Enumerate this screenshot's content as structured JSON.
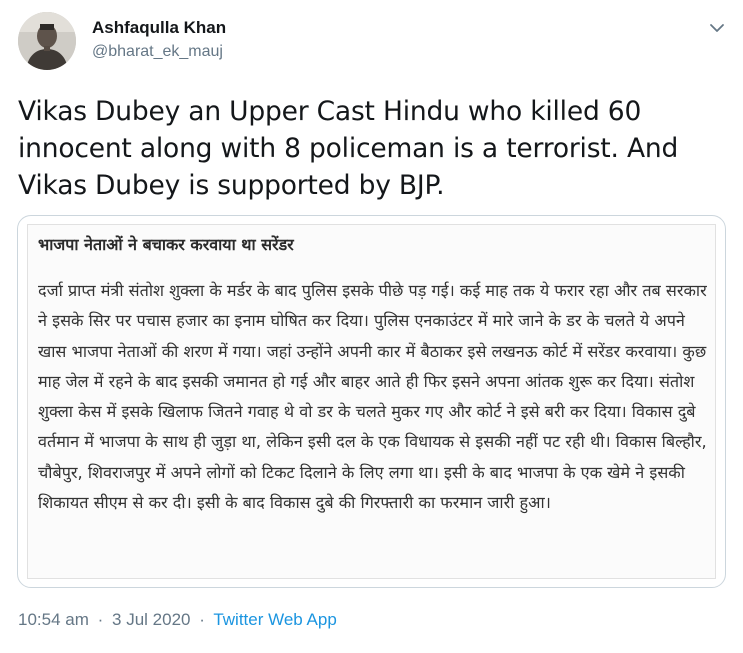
{
  "user": {
    "name": "Ashfaqulla Khan",
    "handle": "@bharat_ek_mauj"
  },
  "tweet": {
    "text": "Vikas Dubey an Upper Cast Hindu who killed 60 innocent along with 8 policeman is a terrorist. And Vikas Dubey is supported by BJP."
  },
  "quoted_image": {
    "headline": "भाजपा नेताओं ने बचाकर करवाया था सरेंडर",
    "body": "दर्जा प्राप्त मंत्री संतोश शुक्ला के मर्डर के बाद पुलिस इसके पीछे पड़ गई। कई माह तक ये फरार रहा और तब सरकार ने इसके सिर पर पचास हजार का इनाम घोषित कर दिया। पुलिस एनकाउंटर में मारे जाने के डर के चलते ये अपने खास भाजपा नेताओं की शरण में गया। जहां उन्होंने अपनी कार में बैठाकर इसे लखनऊ कोर्ट में सरेंडर करवाया। कुछ माह जेल में रहने के बाद इसकी जमानत हो गई और बाहर आते ही फिर इसने अपना आंतक शुरू कर दिया। संतोश शुक्ला केस में इसके खिलाफ जितने गवाह थे वो डर के चलते मुकर गए और कोर्ट ने इसे बरी कर दिया। विकास दुबे वर्तमान में भाजपा के साथ ही जुड़ा था, लेकिन इसी दल के एक विधायक से इसकी नहीं पट रही थी। विकास बिल्हौर, चौबेपुर, शिवराजपुर में अपने लोगों को टिकट दिलाने के लिए लगा था। इसी के बाद भाजपा के एक खेमे ने इसकी शिकायत सीएम से कर दी। इसी के बाद विकास दुबे की गिरफ्तारी का फरमान जारी हुआ।"
  },
  "meta": {
    "time": "10:54 am",
    "separator": "·",
    "date": "3 Jul 2020",
    "source": "Twitter Web App"
  },
  "icons": {
    "caret": "chevron-down-icon"
  },
  "colors": {
    "text": "#14171a",
    "secondary": "#657786",
    "link": "#1b95e0",
    "border": "#ccd6dd"
  }
}
